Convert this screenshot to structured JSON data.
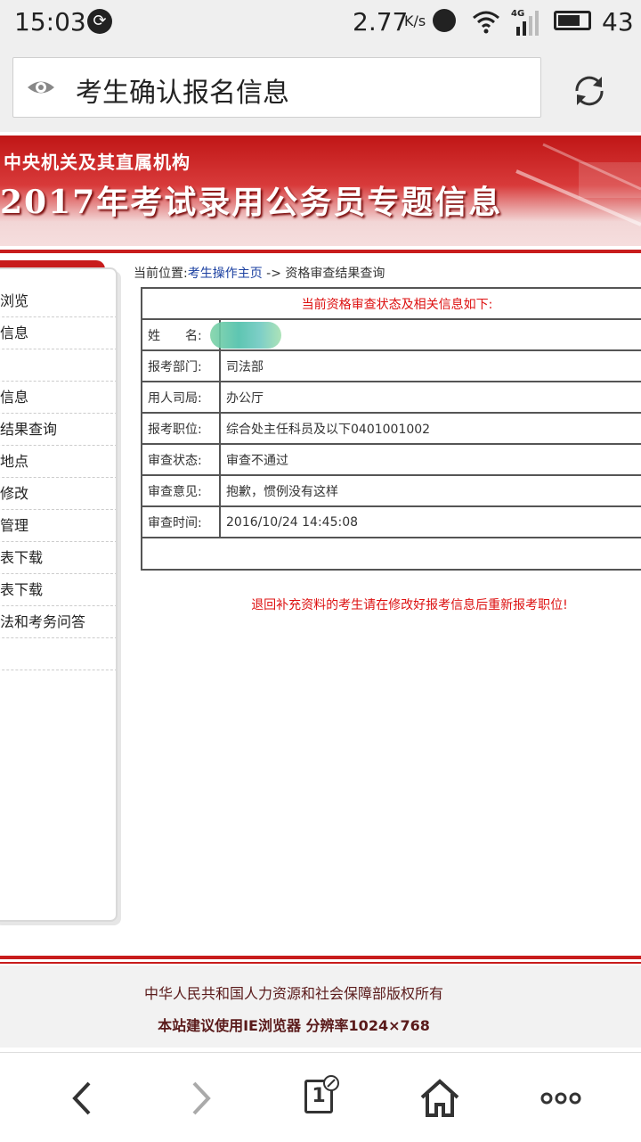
{
  "status_bar": {
    "time": "15:03",
    "speed": "2.77",
    "speed_unit": "K/s",
    "network": "4G",
    "battery": "43"
  },
  "browser": {
    "url_title": "考生确认报名信息"
  },
  "banner": {
    "subtitle": "中央机关及其直属机构",
    "title": "2017年考试录用公务员专题信息"
  },
  "sidebar": {
    "items": [
      "浏览",
      "信息",
      "",
      "信息",
      "结果查询",
      "地点",
      "修改",
      "管理",
      "表下载",
      "表下载",
      "法和考务问答",
      ""
    ]
  },
  "breadcrumb": {
    "prefix": "当前位置:",
    "home": "考生操作主页",
    "separator": " -> ",
    "current": "资格审查结果查询"
  },
  "info_table": {
    "header": "当前资格审查状态及相关信息如下:",
    "rows": [
      {
        "label": "姓　　名:",
        "value": ""
      },
      {
        "label": "报考部门:",
        "value": "司法部"
      },
      {
        "label": "用人司局:",
        "value": "办公厅"
      },
      {
        "label": "报考职位:",
        "value": "综合处主任科员及以下0401001002"
      },
      {
        "label": "审查状态:",
        "value": "审查不通过"
      },
      {
        "label": "审查意见:",
        "value": "抱歉，惯例没有这样"
      },
      {
        "label": "审查时间:",
        "value": "2016/10/24 14:45:08"
      }
    ]
  },
  "notice": "退回补充资料的考生请在修改好报考信息后重新报考职位!",
  "footer": {
    "copyright": "中华人民共和国人力资源和社会保障部版权所有",
    "advice": "本站建议使用IE浏览器 分辨率1024×768"
  },
  "bottom_nav": {
    "tab_count": "1"
  }
}
